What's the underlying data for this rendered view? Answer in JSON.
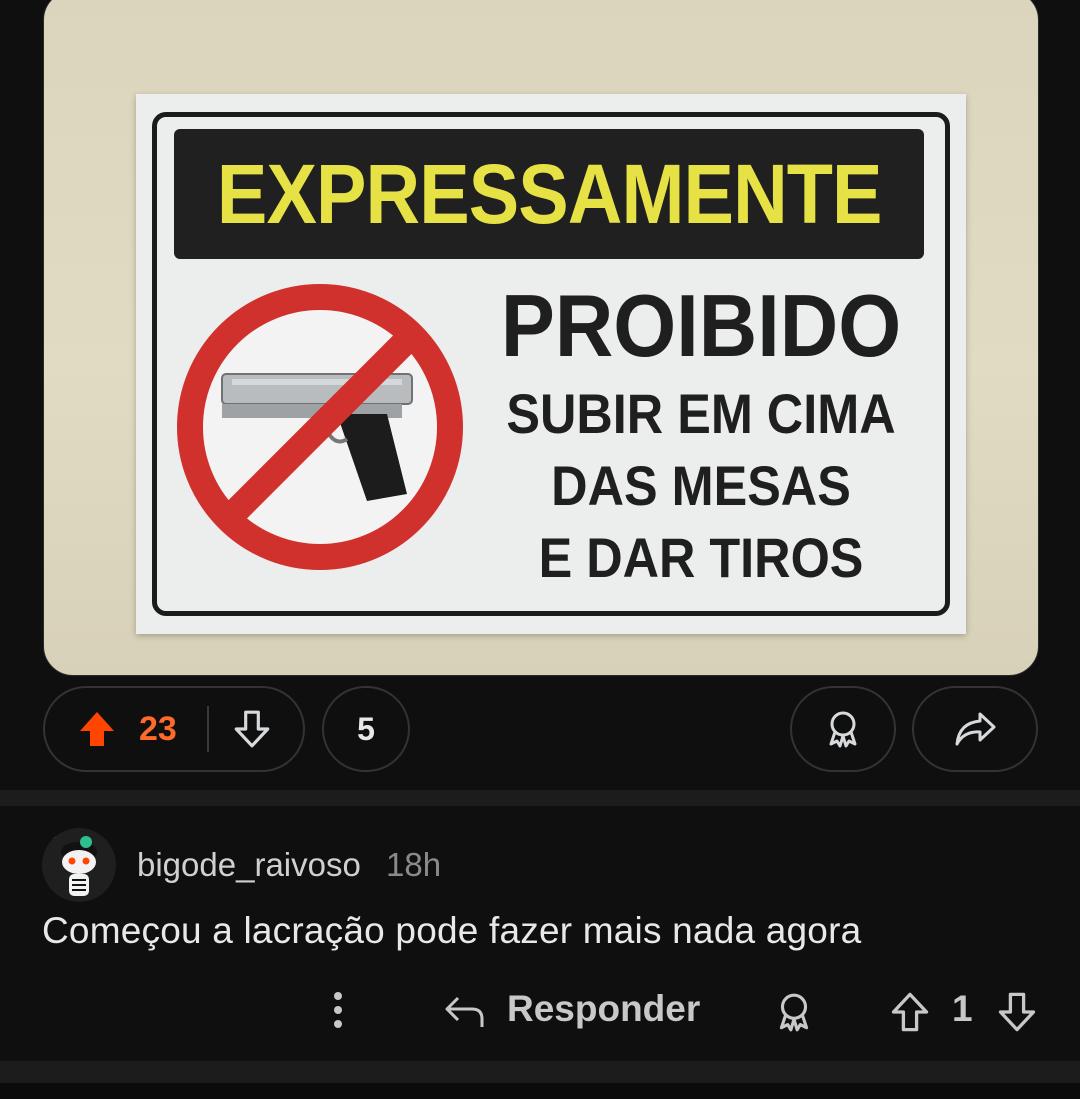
{
  "post": {
    "image": {
      "sign_header": "EXPRESSAMENTE",
      "sign_line1": "PROIBIDO",
      "sign_line2": "SUBIR EM CIMA",
      "sign_line3": "DAS MESAS",
      "sign_line4": "E DAR TIROS"
    },
    "actions": {
      "vote_count": "23",
      "comment_count": "5",
      "icons": [
        "upvote-icon",
        "downvote-icon",
        "award-icon",
        "share-icon"
      ]
    }
  },
  "comment": {
    "author": "bigode_raivoso",
    "time": "18h",
    "body": "Começou a lacração pode fazer mais nada agora",
    "reply_label": "Responder",
    "vote_count": "1"
  },
  "colors": {
    "background": "#0b0b0b",
    "surface": "#0f0f0f",
    "upvote_accent": "#ff4500",
    "vote_count": "#ff6a2a",
    "sign_yellow": "#e6e246",
    "prohibition_red": "#d0312d"
  }
}
